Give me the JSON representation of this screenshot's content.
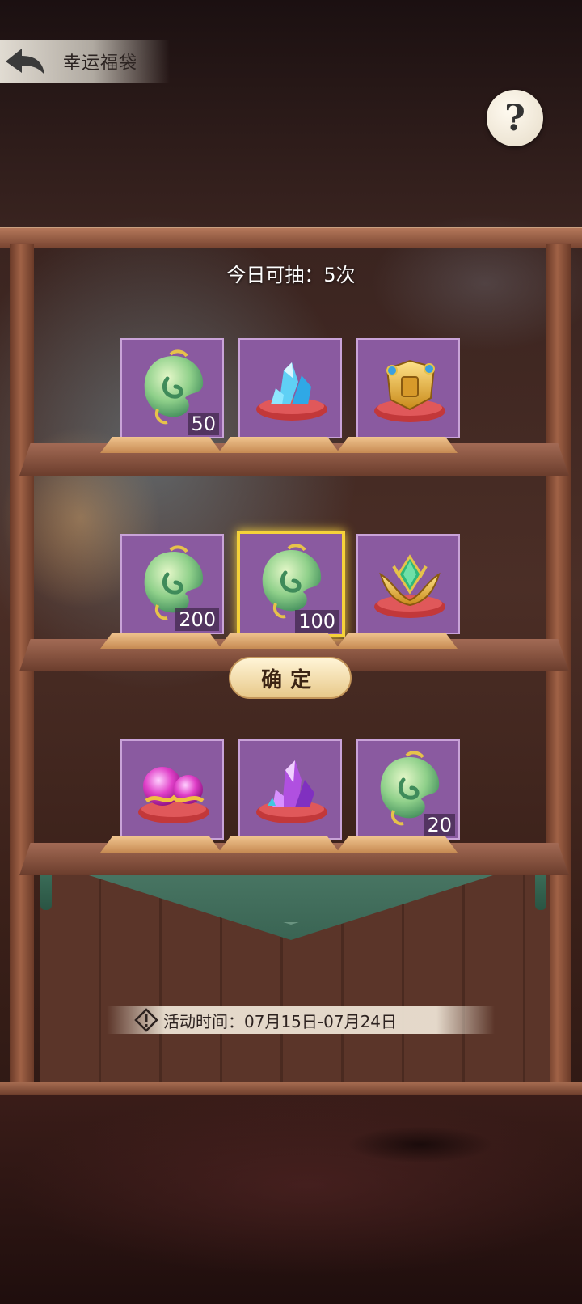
{
  "header": {
    "title": "幸运福袋",
    "back_icon": "back-arrow-icon",
    "help_icon": "question-mark-icon",
    "help_glyph": "?"
  },
  "draw_info": {
    "text": "今日可抽：5次"
  },
  "shelves": [
    {
      "items": [
        {
          "name": "jade-fish",
          "quantity": "50",
          "selected": false
        },
        {
          "name": "blue-crystal-cushion",
          "quantity": "",
          "selected": false
        },
        {
          "name": "golden-armor-cushion",
          "quantity": "",
          "selected": false
        }
      ]
    },
    {
      "items": [
        {
          "name": "jade-fish",
          "quantity": "200",
          "selected": false
        },
        {
          "name": "jade-fish",
          "quantity": "100",
          "selected": true
        },
        {
          "name": "golden-crown-emerald",
          "quantity": "",
          "selected": false
        }
      ]
    },
    {
      "items": [
        {
          "name": "pink-orbs-cushion",
          "quantity": "",
          "selected": false
        },
        {
          "name": "purple-crystal-cushion",
          "quantity": "",
          "selected": false
        },
        {
          "name": "jade-fish",
          "quantity": "20",
          "selected": false
        }
      ]
    }
  ],
  "confirm": {
    "label": "确定"
  },
  "event": {
    "label": "活动时间：",
    "range": "07月15日-07月24日",
    "icon": "warning-icon"
  },
  "colors": {
    "slot_bg": "#8a5aa0",
    "selected_border": "#f5d23a",
    "jade": "#8fd08a"
  }
}
